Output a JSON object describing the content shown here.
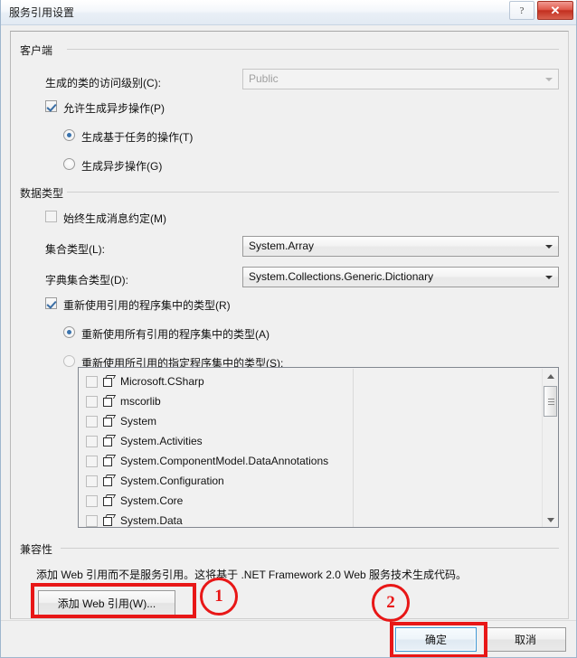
{
  "window": {
    "title": "服务引用设置",
    "help_button": "?",
    "close_button": "✕"
  },
  "groups": {
    "client": {
      "label": "客户端",
      "access_level_label": "生成的类的访问级别(C):",
      "access_level_value": "Public",
      "allow_async_label": "允许生成异步操作(P)",
      "allow_async_checked": true,
      "radio_task_based": "生成基于任务的操作(T)",
      "radio_task_based_selected": true,
      "radio_async": "生成异步操作(G)",
      "radio_async_selected": false
    },
    "datatype": {
      "label": "数据类型",
      "always_message_contract_label": "始终生成消息约定(M)",
      "always_message_contract_checked": false,
      "collection_type_label": "集合类型(L):",
      "collection_type_value": "System.Array",
      "dictionary_type_label": "字典集合类型(D):",
      "dictionary_type_value": "System.Collections.Generic.Dictionary",
      "reuse_types_label": "重新使用引用的程序集中的类型(R)",
      "reuse_types_checked": true,
      "reuse_all_label": "重新使用所有引用的程序集中的类型(A)",
      "reuse_all_selected": true,
      "reuse_specified_label": "重新使用所引用的指定程序集中的类型(S):",
      "reuse_specified_selected": false,
      "assemblies": [
        {
          "name": "Microsoft.CSharp",
          "checked": false
        },
        {
          "name": "mscorlib",
          "checked": false
        },
        {
          "name": "System",
          "checked": false
        },
        {
          "name": "System.Activities",
          "checked": false
        },
        {
          "name": "System.ComponentModel.DataAnnotations",
          "checked": false
        },
        {
          "name": "System.Configuration",
          "checked": false
        },
        {
          "name": "System.Core",
          "checked": false
        },
        {
          "name": "System.Data",
          "checked": false
        }
      ]
    },
    "compatibility": {
      "label": "兼容性",
      "description": "添加 Web 引用而不是服务引用。这将基于 .NET Framework 2.0 Web 服务技术生成代码。",
      "add_web_reference_button": "添加 Web 引用(W)..."
    }
  },
  "footer": {
    "ok_button": "确定",
    "cancel_button": "取消"
  },
  "annotations": {
    "marker_one": "1",
    "marker_two": "2",
    "color": "#e81717"
  }
}
